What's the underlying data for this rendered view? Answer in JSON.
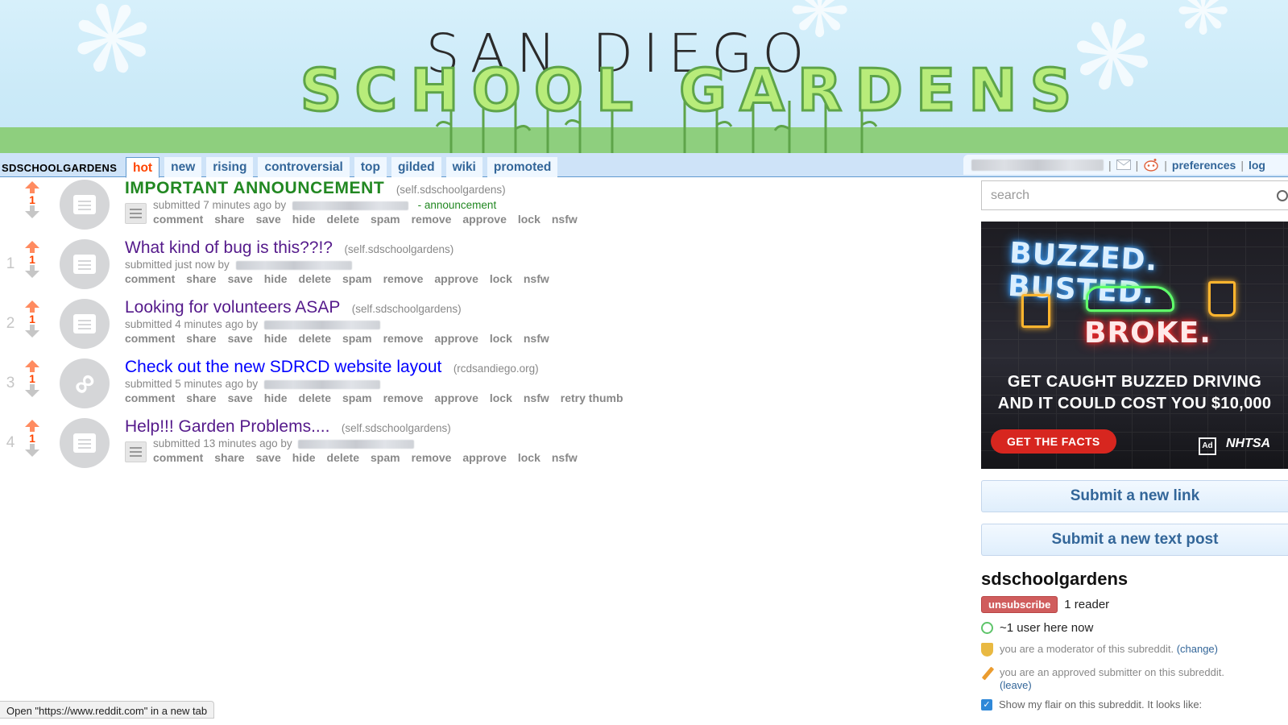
{
  "banner": {
    "title_line_1": "SAN DIEGO",
    "title_line_2": "SCHOOL GARDENS"
  },
  "header": {
    "subreddit_name": "SDSCHOOLGARDENS",
    "tabs": [
      "hot",
      "new",
      "rising",
      "controversial",
      "top",
      "gilded",
      "wiki",
      "promoted"
    ],
    "selected_tab": "hot",
    "user_links": {
      "preferences": "preferences",
      "logout": "log"
    }
  },
  "posts": [
    {
      "rank": "",
      "score": "1",
      "title": "IMPORTANT ANNOUNCEMENT",
      "domain": "(self.sdschoolgardens)",
      "submitted": "submitted 7 minutes ago by",
      "flair": "- announcement",
      "thumb": "text",
      "buttons": [
        "comment",
        "share",
        "save",
        "hide",
        "delete",
        "spam",
        "remove",
        "approve",
        "lock",
        "nsfw"
      ]
    },
    {
      "rank": "1",
      "score": "1",
      "title": "What kind of bug is this??!?",
      "domain": "(self.sdschoolgardens)",
      "submitted": "submitted just now by",
      "flair": "",
      "thumb": "text",
      "buttons": [
        "comment",
        "share",
        "save",
        "hide",
        "delete",
        "spam",
        "remove",
        "approve",
        "lock",
        "nsfw"
      ]
    },
    {
      "rank": "2",
      "score": "1",
      "title": "Looking for volunteers ASAP",
      "domain": "(self.sdschoolgardens)",
      "submitted": "submitted 4 minutes ago by",
      "flair": "",
      "thumb": "text",
      "buttons": [
        "comment",
        "share",
        "save",
        "hide",
        "delete",
        "spam",
        "remove",
        "approve",
        "lock",
        "nsfw"
      ]
    },
    {
      "rank": "3",
      "score": "1",
      "title": "Check out the new SDRCD website layout",
      "domain": "(rcdsandiego.org)",
      "submitted": "submitted 5 minutes ago by",
      "flair": "",
      "thumb": "link",
      "buttons": [
        "comment",
        "share",
        "save",
        "hide",
        "delete",
        "spam",
        "remove",
        "approve",
        "lock",
        "nsfw",
        "retry thumb"
      ]
    },
    {
      "rank": "4",
      "score": "1",
      "title": "Help!!! Garden Problems....",
      "domain": "(self.sdschoolgardens)",
      "submitted": "submitted 13 minutes ago by",
      "flair": "",
      "thumb": "text",
      "buttons": [
        "comment",
        "share",
        "save",
        "hide",
        "delete",
        "spam",
        "remove",
        "approve",
        "lock",
        "nsfw"
      ]
    }
  ],
  "sidebar": {
    "search_placeholder": "search",
    "ad": {
      "neon_line_1": "BUZZED. BUSTED.",
      "neon_line_2": "BROKE.",
      "line_1": "GET CAUGHT BUZZED DRIVING",
      "line_2": "AND IT COULD COST YOU $10,000",
      "cta": "GET THE FACTS",
      "logo_1": "Ad",
      "logo_2": "NHTSA"
    },
    "submit_link": "Submit a new link",
    "submit_text": "Submit a new text post",
    "subreddit_title": "sdschoolgardens",
    "unsubscribe": "unsubscribe",
    "readers": "1 reader",
    "online": "~1 user here now",
    "moderator_text": "you are a moderator of this subreddit.",
    "moderator_change": "(change)",
    "approved_text": "you are an approved submitter on this subreddit.",
    "approved_leave": "(leave)",
    "flair_text": "Show my flair on this subreddit. It looks like:"
  },
  "statusbar": {
    "text": "Open \"https://www.reddit.com\" in a new tab"
  },
  "colors": {
    "link_blue": "#336699",
    "orangered": "#ff4500",
    "upvote": "#ff8b60",
    "announcement_green": "#228822",
    "header_bg": "#cee3f8"
  }
}
